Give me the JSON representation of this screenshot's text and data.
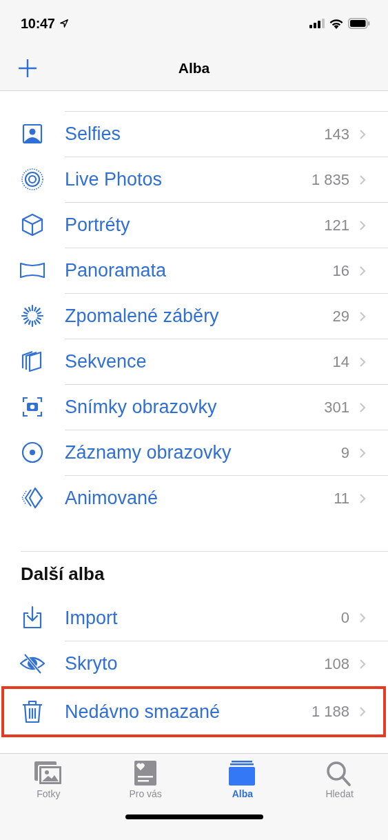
{
  "status_bar": {
    "time": "10:47"
  },
  "nav_bar": {
    "title": "Alba"
  },
  "media_types": [
    {
      "label": "Selfies",
      "count": "143"
    },
    {
      "label": "Live Photos",
      "count": "1 835"
    },
    {
      "label": "Portréty",
      "count": "121"
    },
    {
      "label": "Panoramata",
      "count": "16"
    },
    {
      "label": "Zpomalené záběry",
      "count": "29"
    },
    {
      "label": "Sekvence",
      "count": "14"
    },
    {
      "label": "Snímky obrazovky",
      "count": "301"
    },
    {
      "label": "Záznamy obrazovky",
      "count": "9"
    },
    {
      "label": "Animované",
      "count": "11"
    }
  ],
  "other_albums": {
    "title": "Další alba",
    "items": [
      {
        "label": "Import",
        "count": "0",
        "highlighted": false
      },
      {
        "label": "Skryto",
        "count": "108",
        "highlighted": false
      },
      {
        "label": "Nedávno smazané",
        "count": "1 188",
        "highlighted": true
      }
    ]
  },
  "tabs": [
    {
      "label": "Fotky",
      "selected": false
    },
    {
      "label": "Pro vás",
      "selected": false
    },
    {
      "label": "Alba",
      "selected": true
    },
    {
      "label": "Hledat",
      "selected": false
    }
  ]
}
